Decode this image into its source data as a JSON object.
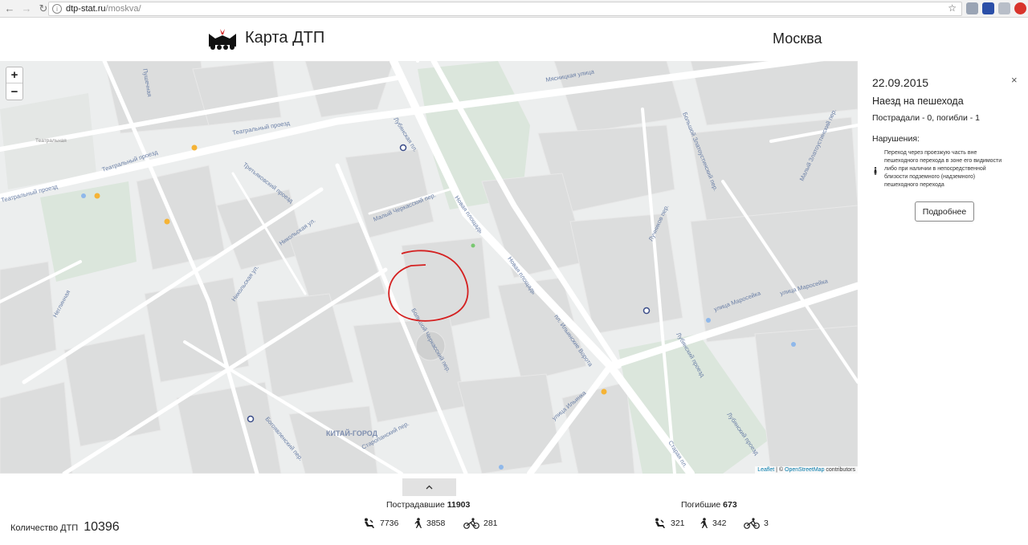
{
  "browser": {
    "url_host": "dtp-stat.ru",
    "url_path": "/moskva/"
  },
  "header": {
    "title": "Карта ДТП",
    "city": "Москва"
  },
  "map": {
    "zoom_in": "+",
    "zoom_out": "−",
    "attribution_leaflet": "Leaflet",
    "attribution_sep": " | © ",
    "attribution_osm": "OpenStreetMap",
    "attribution_tail": " contributors",
    "labels": {
      "teatralnaya": "Театральная",
      "teatr_proezd_1": "Театральный проезд",
      "teatr_proezd_2": "Театральный проезд",
      "teatr_proezd_3": "Театральный проезд",
      "lubyanskaya_pl": "Лубянская пл.",
      "myasnitskaya": "Мясницкая улица",
      "novaya_pl": "Новая площадь",
      "novaya_pl_2": "Новая площадь",
      "ilinskie_vorota": "пл. Ильинские Ворота",
      "maroseyka": "улица Маросейка",
      "maroseyka_2": "улица Маросейка",
      "ilyinka": "улица Ильинка",
      "kitay_gorod": "КИТАЙ-ГОРОД",
      "lubyansky_proezd": "Лубянский проезд",
      "lubyansky_proezd_2": "Лубянский проезд",
      "staraya_pl": "Старая пл.",
      "nikolskaya": "Никольская ул.",
      "nikolskaya_2": "Никольская ул.",
      "bolshoy_cherkassky": "Большой Черкасский пер.",
      "maly_cherkassky": "Малый Черкасский пер.",
      "tretyakovsky": "Третьяковский проезд",
      "bogoyavlensky": "Богоявленский пер.",
      "starapansky": "Старопанский пер.",
      "neglinnaya": "Неглинная",
      "bolshoy_zlatoustinsky": "Большой Златоустинский пер.",
      "maly_zlatoustinsky": "Малый Златоустинский пер.",
      "luchnikov": "Лучников пер.",
      "petrovka": "Пушечная"
    }
  },
  "panel": {
    "date": "22.09.2015",
    "close": "×",
    "type": "Наезд на пешехода",
    "victims": "Пострадали - 0, погибли - 1",
    "violations_title": "Нарушения:",
    "violation_text": "Переход через проезжую часть вне пешеходного перехода в зоне его видимости либо при наличии в непосредственной близости подземного (надземного) пешеходного перехода",
    "more_button": "Подробнее"
  },
  "footer": {
    "toggle_icon": "^",
    "total_label": "Количество ДТП",
    "total_value": "10396",
    "injured_label": "Пострадавшие",
    "injured_value": "11903",
    "injured_drivers": "7736",
    "injured_pedestrians": "3858",
    "injured_cyclists": "281",
    "killed_label": "Погибшие",
    "killed_value": "673",
    "killed_drivers": "321",
    "killed_pedestrians": "342",
    "killed_cyclists": "3"
  },
  "colors": {
    "marker_orange": "#f5b335",
    "marker_blue": "#8fb8ea",
    "marker_green": "#78c870",
    "annotation_red": "#d42020",
    "metro_blue": "#3a4c88"
  }
}
